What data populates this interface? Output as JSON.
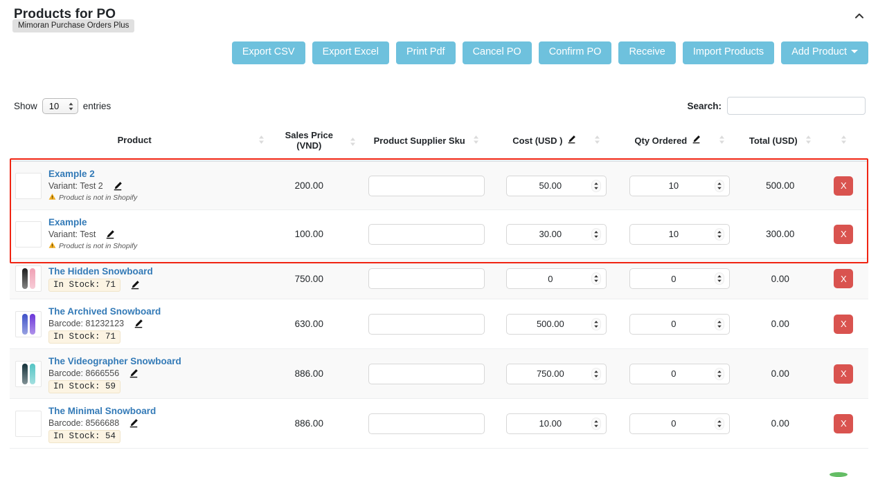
{
  "header": {
    "title": "Products for PO",
    "tooltip": "Mimoran Purchase Orders Plus",
    "collapse_icon": "chevron-up-icon"
  },
  "toolbar": {
    "buttons": [
      {
        "label": "Export CSV",
        "name": "export-csv-button"
      },
      {
        "label": "Export Excel",
        "name": "export-excel-button"
      },
      {
        "label": "Print Pdf",
        "name": "print-pdf-button"
      },
      {
        "label": "Cancel PO",
        "name": "cancel-po-button"
      },
      {
        "label": "Confirm PO",
        "name": "confirm-po-button"
      },
      {
        "label": "Receive",
        "name": "receive-button"
      },
      {
        "label": "Import Products",
        "name": "import-products-button"
      },
      {
        "label": "Add Product",
        "name": "add-product-button",
        "caret": true
      }
    ],
    "accent_color": "#6ec1dd"
  },
  "controls": {
    "show_label": "Show",
    "entries_label": "entries",
    "page_size": "10",
    "search_label": "Search:",
    "search_value": "",
    "search_placeholder": ""
  },
  "table": {
    "columns": [
      "Product",
      "Sales Price (VND)",
      "Product Supplier Sku",
      "Cost (USD )",
      "Qty Ordered",
      "Total (USD)"
    ],
    "col_sales_line1": "Sales Price",
    "col_sales_line2": "(VND)",
    "rows": [
      {
        "name": "Example 2",
        "sub_label": "Variant: Test 2",
        "sub_type": "variant",
        "warning": "Product is not in Shopify",
        "thumb_colors": [],
        "sales_price": "200.00",
        "supplier_sku": "",
        "cost": "50.00",
        "qty": "10",
        "total": "500.00",
        "remove_label": "X",
        "highlighted": true
      },
      {
        "name": "Example",
        "sub_label": "Variant: Test",
        "sub_type": "variant",
        "warning": "Product is not in Shopify",
        "thumb_colors": [],
        "sales_price": "100.00",
        "supplier_sku": "",
        "cost": "30.00",
        "qty": "10",
        "total": "300.00",
        "remove_label": "X",
        "highlighted": true
      },
      {
        "name": "The Hidden Snowboard",
        "sub_label": "",
        "sub_type": "stock",
        "stock": "In Stock: 71",
        "warning": "",
        "thumb_colors": [
          "#1c1c1c",
          "#f0a0b4"
        ],
        "sales_price": "750.00",
        "supplier_sku": "",
        "cost": "0",
        "qty": "0",
        "total": "0.00",
        "remove_label": "X",
        "highlighted": false
      },
      {
        "name": "The Archived Snowboard",
        "sub_label": "Barcode: 81232123",
        "sub_type": "barcode",
        "stock": "In Stock: 71",
        "warning": "",
        "thumb_colors": [
          "#3f51c8",
          "#6a35d8"
        ],
        "sales_price": "630.00",
        "supplier_sku": "",
        "cost": "500.00",
        "qty": "0",
        "total": "0.00",
        "remove_label": "X",
        "highlighted": false
      },
      {
        "name": "The Videographer Snowboard",
        "sub_label": "Barcode: 8666556",
        "sub_type": "barcode",
        "stock": "In Stock: 59",
        "warning": "",
        "thumb_colors": [
          "#14323a",
          "#54c4c4"
        ],
        "sales_price": "886.00",
        "supplier_sku": "",
        "cost": "750.00",
        "qty": "0",
        "total": "0.00",
        "remove_label": "X",
        "highlighted": false
      },
      {
        "name": "The Minimal Snowboard",
        "sub_label": "Barcode: 8566688",
        "sub_type": "barcode",
        "stock": "In Stock: 54",
        "warning": "",
        "thumb_colors": [],
        "sales_price": "886.00",
        "supplier_sku": "",
        "cost": "10.00",
        "qty": "0",
        "total": "0.00",
        "remove_label": "X",
        "highlighted": false
      }
    ]
  },
  "colors": {
    "button_blue": "#6ec1dd",
    "link_blue": "#337ab7",
    "danger_red": "#d9534f",
    "highlight_red": "#f02311",
    "stock_badge_bg": "#fcf4e3"
  }
}
